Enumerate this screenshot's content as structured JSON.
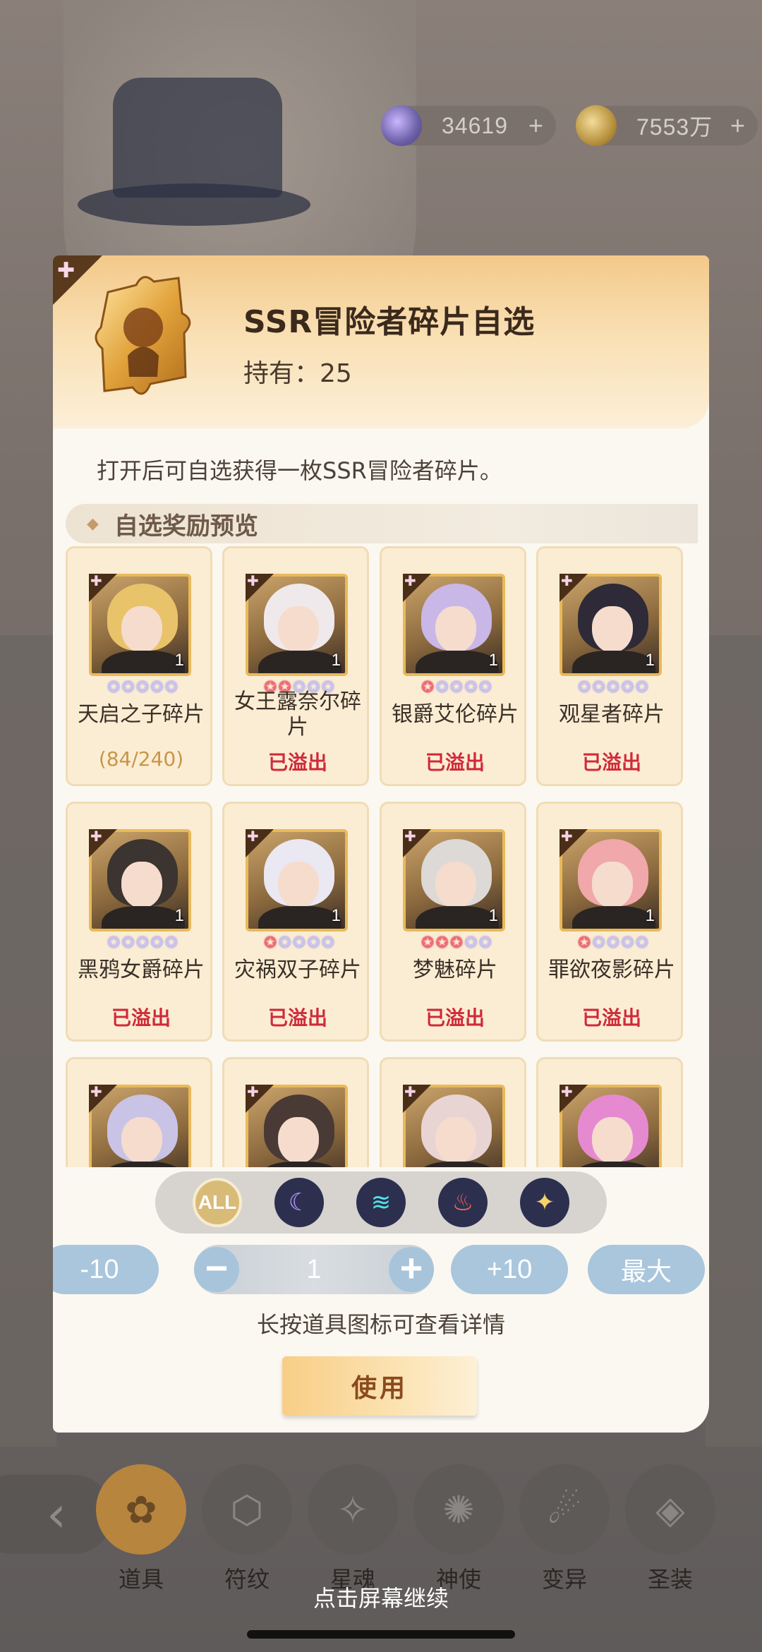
{
  "currencies": [
    {
      "value": "34619",
      "plus": "+"
    },
    {
      "value": "7553万",
      "plus": "+"
    }
  ],
  "dialog": {
    "title": "SSR冒险者碎片自选",
    "hold_label": "持有：25",
    "description": "打开后可自选获得一枚SSR冒险者碎片。",
    "section_title": "自选奖励预览",
    "section_diamond": "◆"
  },
  "cards": [
    {
      "name": "天启之子碎片",
      "status": "(84/240)",
      "count": "1",
      "red_stars": 0,
      "hair": "#e8c36a"
    },
    {
      "name": "女王露奈尔碎片",
      "status": "已溢出",
      "count": "1",
      "red_stars": 2,
      "hair": "#f0e9ec"
    },
    {
      "name": "银爵艾伦碎片",
      "status": "已溢出",
      "count": "1",
      "red_stars": 1,
      "hair": "#c9b7e8"
    },
    {
      "name": "观星者碎片",
      "status": "已溢出",
      "count": "1",
      "red_stars": 0,
      "hair": "#2e2a38"
    },
    {
      "name": "黑鸦女爵碎片",
      "status": "已溢出",
      "count": "1",
      "red_stars": 0,
      "hair": "#3b3430"
    },
    {
      "name": "灾祸双子碎片",
      "status": "已溢出",
      "count": "1",
      "red_stars": 1,
      "hair": "#eae8f2"
    },
    {
      "name": "梦魅碎片",
      "status": "已溢出",
      "count": "1",
      "red_stars": 3,
      "hair": "#dcd9d6"
    },
    {
      "name": "罪欲夜影碎片",
      "status": "已溢出",
      "count": "1",
      "red_stars": 1,
      "hair": "#f0a8aa"
    },
    {
      "name": "",
      "status": "",
      "count": "",
      "red_stars": 0,
      "hair": "#c9c4e6"
    },
    {
      "name": "",
      "status": "",
      "count": "",
      "red_stars": 0,
      "hair": "#4a3a36"
    },
    {
      "name": "",
      "status": "",
      "count": "",
      "red_stars": 0,
      "hair": "#e9d4d4"
    },
    {
      "name": "",
      "status": "",
      "count": "",
      "red_stars": 0,
      "hair": "#e58ad1"
    }
  ],
  "filters": [
    {
      "name": "filter-all-button",
      "label": "ALL",
      "icon": "all-icon",
      "cls": "all"
    },
    {
      "name": "filter-moon-button",
      "label": "☾",
      "icon": "moon-icon",
      "cls": "moon"
    },
    {
      "name": "filter-wind-button",
      "label": "≋",
      "icon": "wind-icon",
      "cls": "wind"
    },
    {
      "name": "filter-fire-button",
      "label": "♨",
      "icon": "fire-icon",
      "cls": "fire"
    },
    {
      "name": "filter-light-button",
      "label": "✦",
      "icon": "light-icon",
      "cls": "light"
    }
  ],
  "quantity": {
    "minus10": "-10",
    "minus": "−",
    "value": "1",
    "plus": "+",
    "plus10": "+10",
    "max": "最大"
  },
  "hint": "长按道具图标可查看详情",
  "use_button": "使用",
  "nav": {
    "back": "‹",
    "items": [
      {
        "label": "道具",
        "icon": "bag-icon",
        "glyph": "✿",
        "active": true
      },
      {
        "label": "符纹",
        "icon": "rune-icon",
        "glyph": "⬡",
        "active": false
      },
      {
        "label": "星魂",
        "icon": "star-soul-icon",
        "glyph": "✧",
        "active": false
      },
      {
        "label": "神使",
        "icon": "envoy-icon",
        "glyph": "✺",
        "active": false
      },
      {
        "label": "变异",
        "icon": "mutation-icon",
        "glyph": "☄",
        "active": false
      },
      {
        "label": "圣装",
        "icon": "holy-gear-icon",
        "glyph": "◈",
        "active": false
      }
    ]
  },
  "continue_text": "点击屏幕继续",
  "colors": {
    "overflow_red": "#d02a3a",
    "progress_gold": "#c99549",
    "star_red": "#f06a78",
    "star_lilac": "#c8c3f0"
  }
}
